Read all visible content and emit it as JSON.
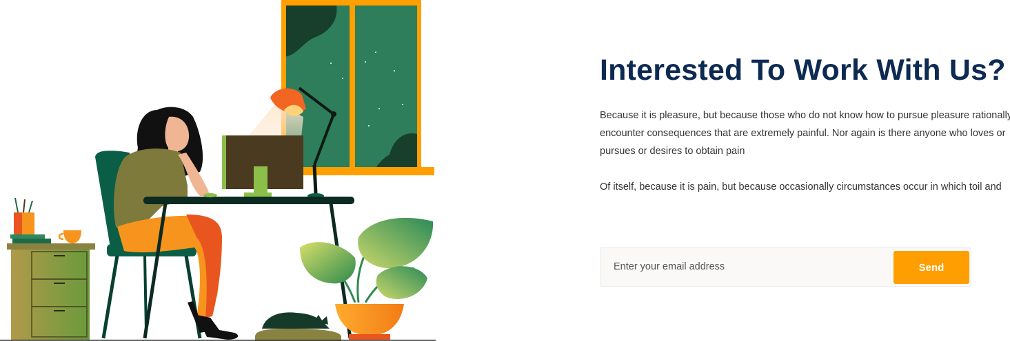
{
  "hero": {
    "title": "Interested To Work With Us?",
    "paragraph_1": "Because it is pleasure, but because those who do not know how to pursue pleasure rationally encounter consequences that are extremely painful. Nor again is there anyone who loves or pursues or desires to obtain pain",
    "paragraph_2": "Of itself, because it is pain, but because occasionally circumstances occur in which toil and"
  },
  "subscribe": {
    "email_placeholder": "Enter your email address",
    "email_value": "",
    "send_label": "Send"
  },
  "colors": {
    "heading": "#0d2a52",
    "accent_orange": "#ff9e00",
    "body_text": "#333333",
    "window_green": "#2e7d5b",
    "chair_green": "#0b5e46",
    "shirt_olive": "#7d7a3b",
    "pants_orange": "#f7941d"
  }
}
